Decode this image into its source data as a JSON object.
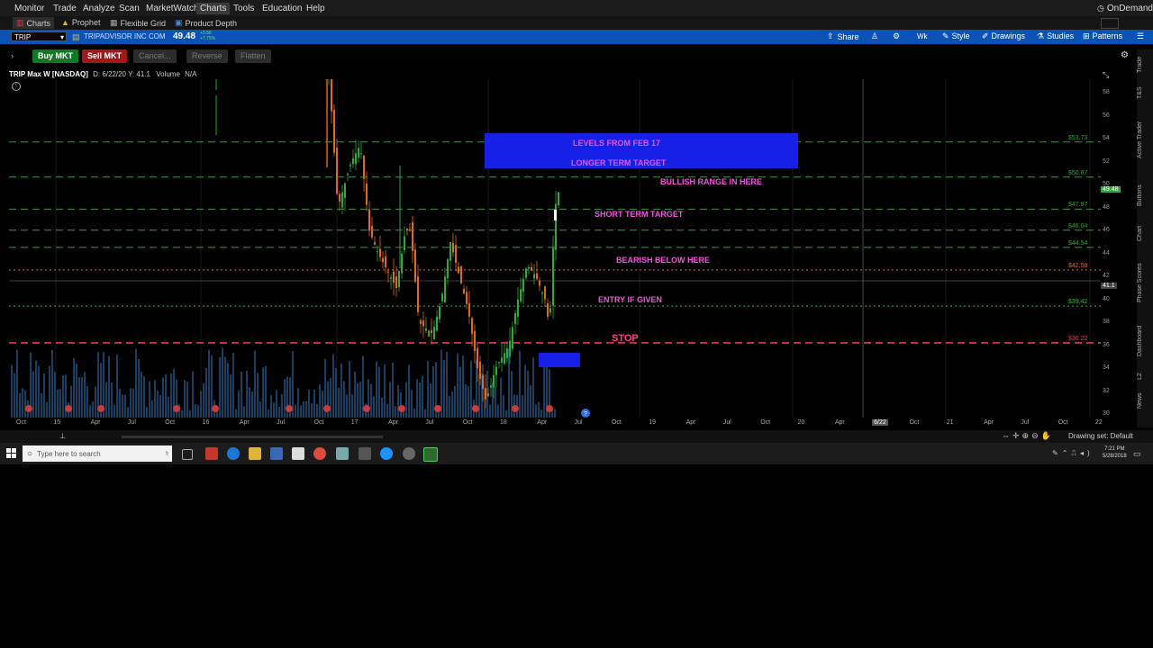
{
  "menu": {
    "items": [
      "Monitor",
      "Trade",
      "Analyze",
      "Scan",
      "MarketWatch",
      "Charts",
      "Tools",
      "Education",
      "Help"
    ],
    "active": "Charts",
    "on_demand": "OnDemand"
  },
  "subnav": {
    "items": [
      "Charts",
      "Prophet",
      "Flexible Grid",
      "Product Depth"
    ]
  },
  "symbolbar": {
    "symbol": "TRIP",
    "company": "TRIPADVISOR INC COM",
    "price": "49.48",
    "change_top": "+3.56",
    "change_bottom": "+7.75%",
    "actions": [
      "Share",
      "Style",
      "Drawings",
      "Studies",
      "Patterns"
    ],
    "timeframe": "Wk"
  },
  "orderbar": {
    "buy": "Buy MKT",
    "sell": "Sell MKT",
    "cancel": "Cancel...",
    "reverse": "Reverse",
    "flatten": "Flatten"
  },
  "chart_header": {
    "title": "TRIP Max W [NASDAQ]",
    "info": "D: 6/22/20  Y: 41.1",
    "volume": "Volume",
    "volume_val": "N/A"
  },
  "annotations": {
    "levels_from": "LEVELS FROM FEB 17",
    "longer_target": "LONGER TERM TARGET",
    "bullish": "BULLISH RANGE IN HERE",
    "short_target": "SHORT TERM TARGET",
    "bearish": "BEARISH BELOW HERE",
    "entry": "ENTRY IF GIVEN",
    "stop": "STOP"
  },
  "price_lines": [
    {
      "value": 53.73,
      "label": "$53.73",
      "color": "#3c9a3c"
    },
    {
      "value": 50.67,
      "label": "$50.67",
      "color": "#3c9a3c"
    },
    {
      "value": 47.87,
      "label": "$47.87",
      "color": "#3c9a3c"
    },
    {
      "value": 46.04,
      "label": "$46.04",
      "color": "#3c9a3c"
    },
    {
      "value": 44.54,
      "label": "$44.54",
      "color": "#3c9a3c"
    },
    {
      "value": 42.58,
      "label": "$42.58",
      "color": "#d2693c"
    },
    {
      "value": 39.42,
      "label": "$39.42",
      "color": "#3cb43c"
    },
    {
      "value": 36.22,
      "label": "$36.22",
      "color": "#e03c5a"
    }
  ],
  "yaxis": {
    "ticks": [
      "58",
      "56",
      "54",
      "52",
      "50",
      "48",
      "46",
      "44",
      "42",
      "40",
      "38",
      "36",
      "34",
      "32",
      "30"
    ],
    "last_price": "49.48",
    "crosshair": "41.1",
    "min": 29.7,
    "max": 59.2
  },
  "xaxis": {
    "ticks": [
      "Oct",
      "15",
      "Apr",
      "Jul",
      "Oct",
      "16",
      "Apr",
      "Jul",
      "Oct",
      "17",
      "Apr",
      "Jul",
      "Oct",
      "18",
      "Apr",
      "Jul",
      "Oct",
      "19",
      "Apr",
      "Jul",
      "Oct",
      "20",
      "Apr",
      "6/22",
      "Oct",
      "21",
      "Apr",
      "Jul",
      "Oct",
      "22"
    ]
  },
  "bottom": {
    "drawing_set": "Drawing set: Default"
  },
  "right_tabs": [
    "Trade",
    "T&S",
    "Active Trader",
    "Buttons",
    "Chart",
    "Phase Scores",
    "Dashboard",
    "L2",
    "News"
  ],
  "taskbar": {
    "search_placeholder": "Type here to search",
    "time": "7:21 PM",
    "date": "5/28/2018"
  },
  "colors": {
    "accent_blue": "#0a53b4",
    "annotation_pink": "#ee55dd",
    "up_green": "#2faa3a",
    "down_orange": "#e06a1e",
    "volume_blue": "#1e4a73"
  }
}
